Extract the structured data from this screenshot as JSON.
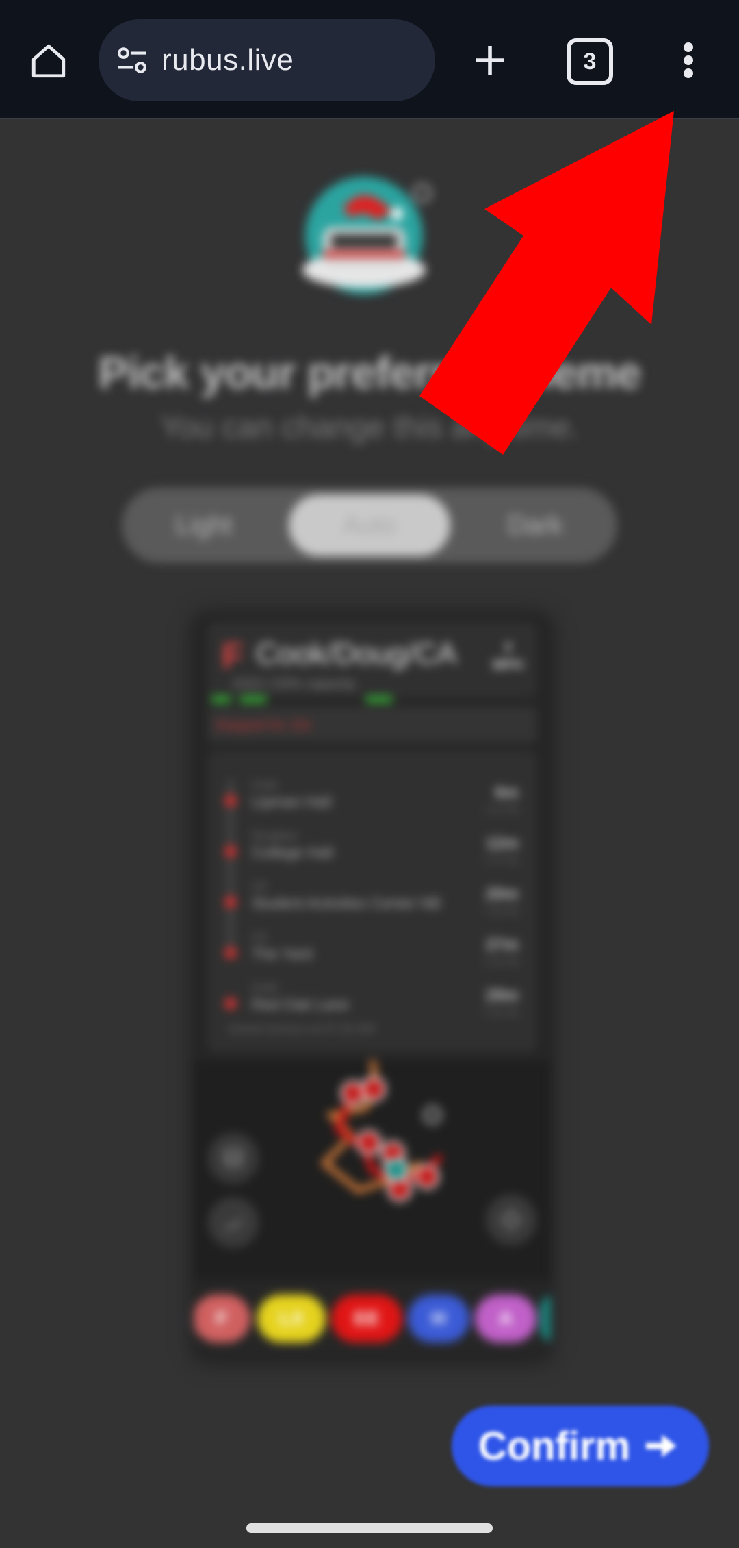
{
  "browser": {
    "url": "rubus.live",
    "tab_count": "3",
    "icons": {
      "home": "home-icon",
      "site_info": "tune-icon",
      "new_tab": "plus-icon",
      "tabs": "tab-switcher-icon",
      "menu": "more-vert-icon"
    }
  },
  "page": {
    "heading": "Pick your preferred theme",
    "subheading": "You can change this any time.",
    "theme_options": [
      "Light",
      "Auto",
      "Dark"
    ],
    "selected_theme": "Auto",
    "confirm_label": "Confirm"
  },
  "preview": {
    "route_letter": "F",
    "route_name": "Cook/Doug/CA",
    "capacity": "#322 | 53% capacity",
    "speed_value": "4",
    "speed_unit": "MPH",
    "status": "Stopped for 10s",
    "stops": [
      {
        "line": "Cook",
        "name": "Lipman Hall",
        "eta": "6m",
        "time": "7:31 PM"
      },
      {
        "line": "Douglass",
        "name": "College Hall",
        "eta": "12m",
        "time": "7:37 PM"
      },
      {
        "line": "CA",
        "name": "Student Activities Center NB",
        "eta": "20m",
        "time": "7:45 PM"
      },
      {
        "line": "CA",
        "name": "The Yard",
        "eta": "27m",
        "time": "7:52 PM"
      },
      {
        "line": "Cook",
        "name": "Red Oak Lane",
        "eta": "29m",
        "time": "7:54 PM"
      }
    ],
    "service_note": "Joined service at 07:25 AM",
    "route_chips": [
      {
        "label": "F",
        "color": "#d06060"
      },
      {
        "label": "LX",
        "color": "#e5d21e"
      },
      {
        "label": "EE",
        "color": "#e01515"
      },
      {
        "label": "H",
        "color": "#3b5bd6"
      },
      {
        "label": "A",
        "color": "#c060c8"
      }
    ]
  },
  "colors": {
    "accent": "#2f55e8",
    "annotation_arrow": "#ff0000"
  }
}
